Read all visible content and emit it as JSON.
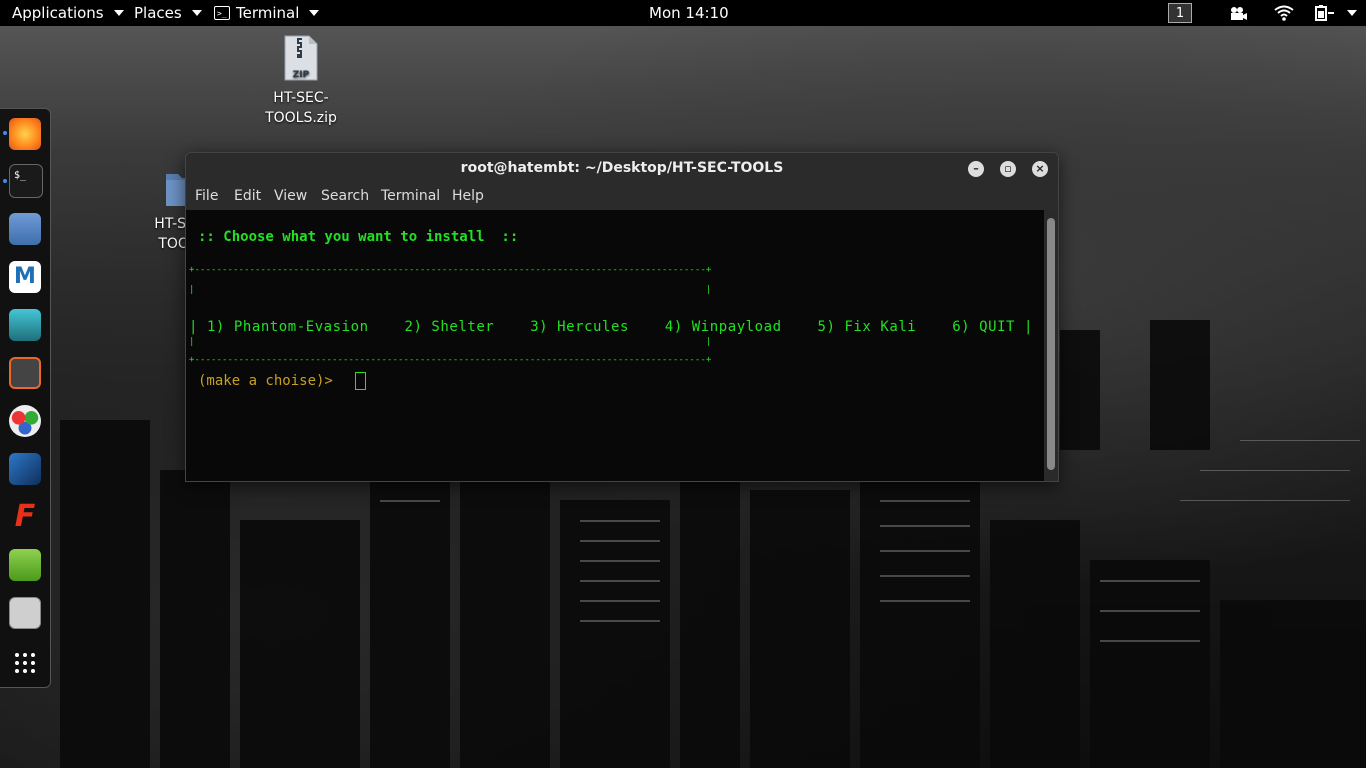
{
  "topbar": {
    "applications": "Applications",
    "places": "Places",
    "terminal": "Terminal",
    "clock": "Mon 14:10",
    "workspace": "1",
    "icons": [
      "camera-icon",
      "wifi-icon",
      "power-battery-icon"
    ]
  },
  "desktop": {
    "zip_badge": "ZIP",
    "zip_name_line1": "HT-SEC-",
    "zip_name_line2": "TOOLS.zip",
    "folder_name_line1": "HT-SEC-",
    "folder_name_line2": "TOOLS"
  },
  "dock": {
    "apps": [
      "firefox-icon",
      "terminal-icon",
      "files-icon",
      "metasploit-icon",
      "armitage-icon",
      "burpsuite-icon",
      "maltego-icon",
      "beef-icon",
      "faraday-icon",
      "leafpad-icon",
      "cherrytree-icon",
      "show-apps-icon"
    ]
  },
  "window": {
    "title": "root@hatembt: ~/Desktop/HT-SEC-TOOLS",
    "menu": [
      "File",
      "Edit",
      "View",
      "Search",
      "Terminal",
      "Help"
    ],
    "terminal": {
      "heading": ":: Choose what you want to install  ::",
      "border": "+---------------------------------------------------------------------------------------------+",
      "empty_row": "|                                                                                             |",
      "options_row": "| 1) Phantom-Evasion    2) Shelter    3) Hercules    4) Winpayload    5) Fix Kali    6) QUIT |",
      "prompt": "(make a choise)>"
    }
  },
  "colors": {
    "terminal_green": "#22e022",
    "prompt_yellow": "#c8a020",
    "topbar_bg": "#000000"
  }
}
